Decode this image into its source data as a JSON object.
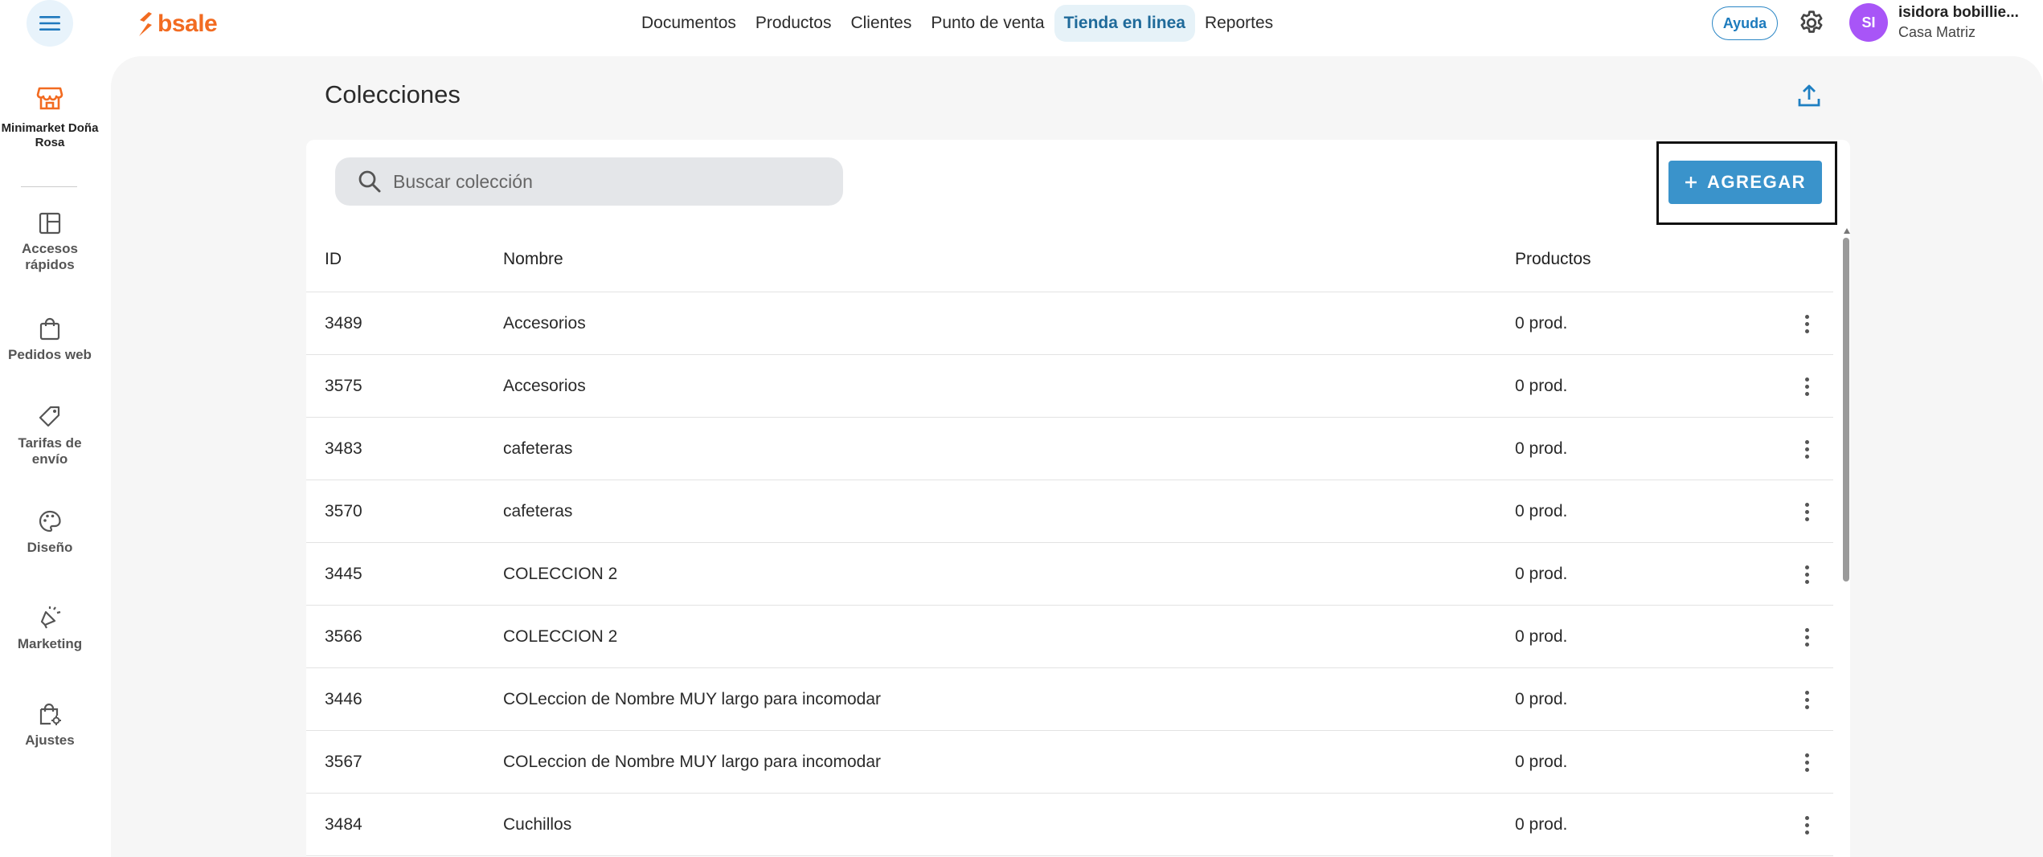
{
  "header": {
    "logo_text": "bsale",
    "nav": [
      {
        "label": "Documentos",
        "active": false
      },
      {
        "label": "Productos",
        "active": false
      },
      {
        "label": "Clientes",
        "active": false
      },
      {
        "label": "Punto de venta",
        "active": false
      },
      {
        "label": "Tienda en linea",
        "active": true
      },
      {
        "label": "Reportes",
        "active": false
      }
    ],
    "help_label": "Ayuda",
    "avatar_initials": "SI",
    "user_name": "isidora bobillie...",
    "user_branch": "Casa Matriz"
  },
  "sidebar": {
    "store_name": "Minimarket Doña Rosa",
    "items": [
      {
        "label": "Accesos rápidos",
        "icon": "layout-icon"
      },
      {
        "label": "Pedidos web",
        "icon": "shopping-bag-icon"
      },
      {
        "label": "Tarifas de envío",
        "icon": "tag-icon"
      },
      {
        "label": "Diseño",
        "icon": "palette-icon"
      },
      {
        "label": "Marketing",
        "icon": "megaphone-icon"
      },
      {
        "label": "Ajustes",
        "icon": "bag-settings-icon"
      }
    ]
  },
  "page": {
    "title": "Colecciones",
    "search_placeholder": "Buscar colección",
    "add_button_label": "AGREGAR"
  },
  "table": {
    "columns": {
      "id": "ID",
      "name": "Nombre",
      "products": "Productos"
    },
    "rows": [
      {
        "id": "3489",
        "name": "Accesorios",
        "products": "0 prod."
      },
      {
        "id": "3575",
        "name": "Accesorios",
        "products": "0 prod."
      },
      {
        "id": "3483",
        "name": "cafeteras",
        "products": "0 prod."
      },
      {
        "id": "3570",
        "name": "cafeteras",
        "products": "0 prod."
      },
      {
        "id": "3445",
        "name": "COLECCION 2",
        "products": "0 prod."
      },
      {
        "id": "3566",
        "name": "COLECCION 2",
        "products": "0 prod."
      },
      {
        "id": "3446",
        "name": "COLeccion de Nombre MUY largo para incomodar",
        "products": "0 prod."
      },
      {
        "id": "3567",
        "name": "COLeccion de Nombre MUY largo para incomodar",
        "products": "0 prod."
      },
      {
        "id": "3484",
        "name": "Cuchillos",
        "products": "0 prod."
      }
    ]
  },
  "colors": {
    "brand": "#f26b21",
    "accent": "#3a93cb",
    "avatar": "#a855f7"
  }
}
